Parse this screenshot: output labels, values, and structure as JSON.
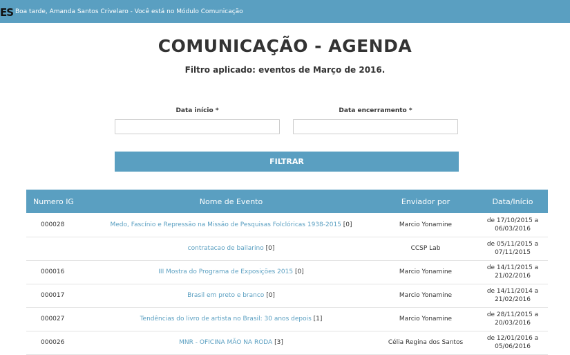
{
  "header": {
    "logo": "ES",
    "greeting": "Boa tarde, Amanda Santos Crivelaro - Você está no Módulo Comunicação"
  },
  "page": {
    "title": "COMUNICAÇÃO - AGENDA",
    "subtitle": "Filtro aplicado: eventos de Março de 2016."
  },
  "filter": {
    "start_label": "Data início *",
    "start_value": "",
    "end_label": "Data encerramento *",
    "end_value": "",
    "button_label": "FILTRAR"
  },
  "table": {
    "headers": [
      "Numero IG",
      "Nome de Evento",
      "Enviador por",
      "Data/Início"
    ],
    "rows": [
      {
        "id": "000028",
        "name": "Medo, Fascínio e Repressão na Missão de Pesquisas Folclóricas 1938-2015",
        "count": "[0]",
        "sender": "Marcio Yonamine",
        "date1": "de 17/10/2015 a",
        "date2": "06/03/2016"
      },
      {
        "id": "",
        "name": "contratacao de bailarino",
        "count": "[0]",
        "sender": "CCSP Lab",
        "date1": "de 05/11/2015 a",
        "date2": "07/11/2015"
      },
      {
        "id": "000016",
        "name": "III Mostra do Programa de Exposições 2015",
        "count": "[0]",
        "sender": "Marcio Yonamine",
        "date1": "de 14/11/2015 a",
        "date2": "21/02/2016"
      },
      {
        "id": "000017",
        "name": "Brasil em preto e branco",
        "count": "[0]",
        "sender": "Marcio Yonamine",
        "date1": "de 14/11/2014 a",
        "date2": "21/02/2016"
      },
      {
        "id": "000027",
        "name": "Tendências do livro de artista no Brasil: 30 anos depois",
        "count": "[1]",
        "sender": "Marcio Yonamine",
        "date1": "de 28/11/2015 a",
        "date2": "20/03/2016"
      },
      {
        "id": "000026",
        "name": "MNR - OFICINA MÃO NA RODA",
        "count": "[3]",
        "sender": "Célia Regina dos Santos",
        "date1": "de 12/01/2016 a",
        "date2": "05/06/2016"
      }
    ]
  }
}
